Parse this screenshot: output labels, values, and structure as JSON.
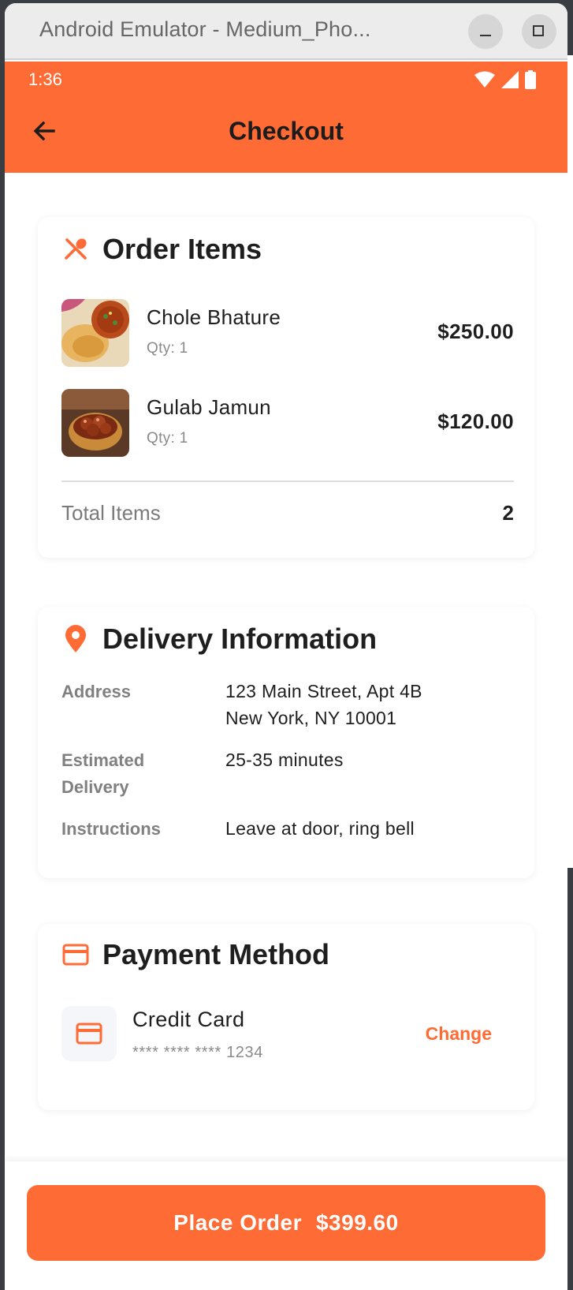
{
  "window": {
    "title": "Android Emulator - Medium_Pho..."
  },
  "status_bar": {
    "time": "1:36"
  },
  "header": {
    "title": "Checkout"
  },
  "order_items": {
    "title": "Order Items",
    "items": [
      {
        "name": "Chole Bhature",
        "qty": "Qty: 1",
        "price": "$250.00"
      },
      {
        "name": "Gulab Jamun",
        "qty": "Qty: 1",
        "price": "$120.00"
      }
    ],
    "total_label": "Total Items",
    "total_value": "2"
  },
  "delivery": {
    "title": "Delivery Information",
    "address_label": "Address",
    "address_line1": "123 Main Street, Apt 4B",
    "address_line2": "New York, NY 10001",
    "eta_label_line1": "Estimated",
    "eta_label_line2": "Delivery",
    "eta_value": "25-35 minutes",
    "instructions_label": "Instructions",
    "instructions_value": "Leave at door, ring bell"
  },
  "payment": {
    "title": "Payment Method",
    "method": "Credit Card",
    "masked_number": "**** **** **** 1234",
    "change_label": "Change"
  },
  "checkout": {
    "button_label": "Place Order",
    "button_amount": "$399.60"
  },
  "colors": {
    "accent": "#ff6b35",
    "text_primary": "#1e1e1e",
    "text_secondary": "#808080"
  }
}
